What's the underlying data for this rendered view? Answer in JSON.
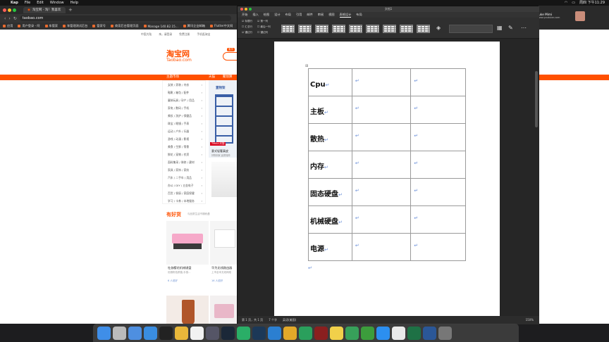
{
  "menubar": {
    "app": "Kap",
    "items": [
      "File",
      "Edit",
      "Window",
      "Help"
    ],
    "clock": "周四 下午11:29"
  },
  "browser": {
    "tab_title": "淘宝网 - 淘！我喜欢",
    "url": "taobao.com",
    "bookmarks": [
      "应用",
      "用户登录 - 阿",
      "车管家",
      "车管理测试后台",
      "管家号",
      "商家后台管理页面",
      "Manage 140.82.15...",
      "腾讯企业邮箱",
      "Flutter中文网",
      "用户名",
      "API接口文档",
      "海象资料"
    ],
    "profile_name": "Luke Mimi",
    "profile_sub": "www.youtube.com"
  },
  "taobao": {
    "sitenav": [
      "中国大陆",
      "亲，请登录",
      "免费注册",
      "手机逛淘宝"
    ],
    "logo": "淘宝网",
    "logo_en": "Taobao.com",
    "search_tag": "宝贝",
    "bar_main": "主题市场",
    "bar_tmall": "天猫",
    "bar_ju": "聚划算",
    "categories": [
      "女装 / 男装 / 内衣",
      "鞋靴 / 箱包 / 配件",
      "童装玩具 / 孕产 / 用品",
      "家电 / 数码 / 手机",
      "美妆 / 洗护 / 保健品",
      "珠宝 / 眼镜 / 手表",
      "运动 / 户外 / 乐器",
      "游戏 / 动漫 / 影视",
      "美食 / 生鲜 / 零食",
      "鲜花 / 宠物 / 农资",
      "面料集采 / 装修 / 建材",
      "家具 / 家饰 / 家纺",
      "汽车 / 二手车 / 用品",
      "办公 / DIY / 五金电子",
      "百货 / 餐厨 / 家庭保健",
      "学习 / 卡券 / 本地服务"
    ],
    "promo_title": "置物架",
    "promo_brand": "TMALL天猫",
    "promo_caption": "意式轻奢真皮",
    "promo_caption2": "好物到家,品质保障",
    "hot_title": "有好货",
    "hot_sub": "与品质生活不期而遇",
    "card1_title": "杜伽樱花机械键盘",
    "card1_sub": "优雅粉色颜值,手感...",
    "card1_link": "6 人说好",
    "card2_title": "华为无线路由器",
    "card2_sub": "上市全本无线网络",
    "card2_link": "16 人说好"
  },
  "word": {
    "title": "文档1",
    "tabs": [
      "开始",
      "插入",
      "绘图",
      "设计",
      "布局",
      "引用",
      "邮件",
      "审阅",
      "视图",
      "表格设计",
      "布局"
    ],
    "active_tab": "表格设计",
    "ribbon_checks": [
      "标题行",
      "汇总行",
      "镶边行",
      "第一列",
      "最后一列",
      "镶边列"
    ],
    "table_rows": [
      "Cpu",
      "主板",
      "散热",
      "内存",
      "固态硬盘",
      "机械硬盘",
      "电源"
    ],
    "return_mark": "↵",
    "status_page": "第 1 页，共 1 页",
    "status_words": "7 个字",
    "status_lang": "英语(美国)",
    "zoom": "150%"
  },
  "dock": {
    "apps": [
      "Finder",
      "Launchpad",
      "Xcode",
      "Safari",
      "Terminal",
      "Chrome",
      "Circle",
      "Clapper",
      "Steam",
      "WeChat",
      "Photoshop",
      "VSCode",
      "Tools",
      "Stats",
      "Dictionary",
      "Notes",
      "Sheets",
      "Evernote",
      "App Store",
      "Calendar",
      "Excel",
      "Word",
      "Trash"
    ],
    "colors": [
      "#3f8ee8",
      "#bbbbbb",
      "#4e8fe0",
      "#3a8de0",
      "#222222",
      "#e8b73a",
      "#f2f2f2",
      "#556",
      "#1b2838",
      "#2aae67",
      "#1c3857",
      "#2b7fd1",
      "#e2a829",
      "#2a9f5c",
      "#8a1f1f",
      "#f1d04a",
      "#37a05a",
      "#3c9d3c",
      "#2c8ff0",
      "#e9e9e9",
      "#1e7145",
      "#2b5797",
      "#777777"
    ]
  }
}
